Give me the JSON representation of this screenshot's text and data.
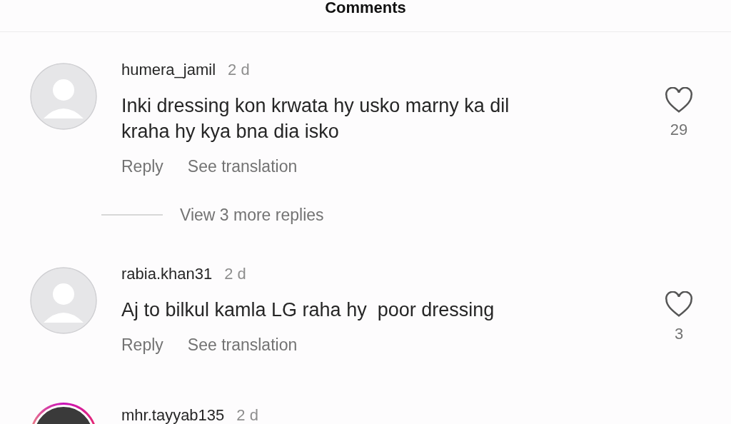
{
  "header": {
    "title": "Comments"
  },
  "comments": [
    {
      "username": "humera_jamil",
      "time": "2 d",
      "text": "Inki dressing kon krwata hy usko marny ka dil kraha hy kya bna dia isko",
      "kind": "default",
      "has_story": false,
      "likes": "29",
      "liked": false,
      "reply": "Reply",
      "translate": "See translation",
      "more_replies": "View 3 more replies"
    },
    {
      "username": "rabia.khan31",
      "time": "2 d",
      "text": "Aj to bilkul kamla LG raha hy  poor dressing",
      "kind": "default",
      "has_story": false,
      "likes": "3",
      "liked": false,
      "reply": "Reply",
      "translate": "See translation"
    },
    {
      "username": "mhr.tayyab135",
      "time": "2 d",
      "kind": "photo",
      "has_story": true
    }
  ]
}
